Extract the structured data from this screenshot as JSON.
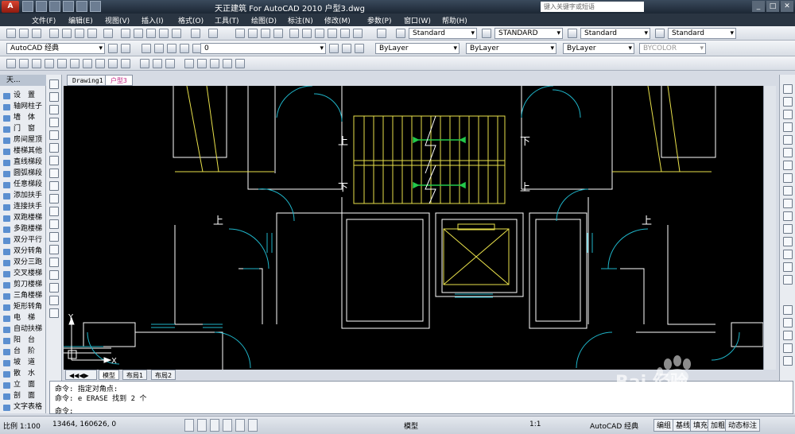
{
  "app": {
    "title": "天正建筑 For AutoCAD 2010       户型3.dwg",
    "search_placeholder": "键入关键字或短语",
    "menu": [
      "文件(F)",
      "编辑(E)",
      "视图(V)",
      "插入(I)",
      "格式(O)",
      "工具(T)",
      "绘图(D)",
      "标注(N)",
      "修改(M)",
      "参数(P)",
      "窗口(W)",
      "帮助(H)"
    ]
  },
  "toolbar": {
    "text_style": "Standard",
    "dim_style": "STANDARD",
    "table_style": "Standard",
    "multileader_style": "Standard",
    "workspace": "AutoCAD 经典",
    "layer": "0",
    "color": "ByLayer",
    "linetype": "ByLayer",
    "lineweight": "ByLayer",
    "plotstyle": "BYCOLOR"
  },
  "left_palette": {
    "header": "天...",
    "items": [
      "设　置",
      "轴网柱子",
      "墙　体",
      "门　窗",
      "房间屋顶",
      "楼梯其他",
      "直线梯段",
      "圆弧梯段",
      "任意梯段",
      "添加扶手",
      "连接扶手",
      "双跑楼梯",
      "多跑楼梯",
      "双分平行",
      "双分转角",
      "双分三跑",
      "交叉楼梯",
      "剪刀楼梯",
      "三角楼梯",
      "矩形转角",
      "电　梯",
      "自动扶梯",
      "阳　台",
      "台　阶",
      "坡　道",
      "散　水",
      "立　面",
      "剖　面",
      "文字表格"
    ]
  },
  "doc_tabs": [
    "Drawing1",
    "户型3"
  ],
  "layout_tabs": [
    "模型",
    "布局1",
    "布局2"
  ],
  "canvas": {
    "stair_up_labels": [
      "上",
      "上",
      "上"
    ],
    "stair_down_labels": [
      "下",
      "下"
    ],
    "ucs_x": "X",
    "ucs_y": "Y"
  },
  "command_lines": [
    "命令: 指定对角点:",
    "命令: e ERASE 找到 2 个",
    "命令:"
  ],
  "status": {
    "scale": "比例 1:100",
    "coords": "13464, 160626, 0",
    "model_label": "模型",
    "anno_scale": "1:1",
    "workspace": "AutoCAD 经典",
    "buttons": [
      "编组",
      "基线",
      "填充",
      "加粗",
      "动态标注"
    ]
  },
  "watermark": "Bai 经验"
}
